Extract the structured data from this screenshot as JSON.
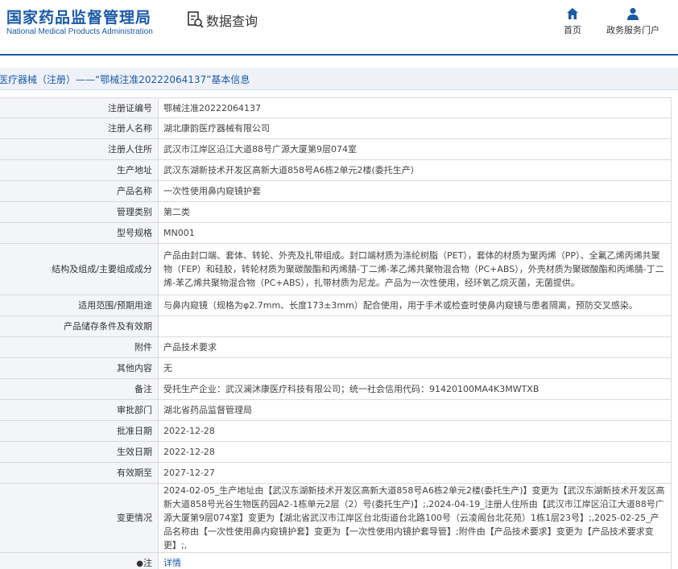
{
  "site": {
    "name_cn": "国家药品监督管理局",
    "name_en": "National Medical Products Administration",
    "query_title": "数据查询"
  },
  "nav": {
    "home": "首页",
    "portal": "政务服务门户"
  },
  "breadcrumb": "医疗器械（注册）——“鄂械注准20222064137”基本信息",
  "rows": [
    {
      "label": "注册证编号",
      "value": "鄂械注准20222064137"
    },
    {
      "label": "注册人名称",
      "value": "湖北康韵医疗器械有限公司"
    },
    {
      "label": "注册人住所",
      "value": "武汉市江岸区沿江大道88号广源大厦第9层074室"
    },
    {
      "label": "生产地址",
      "value": "武汉东湖新技术开发区高新大道858号A6栋2单元2楼(委托生产）"
    },
    {
      "label": "产品名称",
      "value": "一次性使用鼻内窥镜护套"
    },
    {
      "label": "管理类别",
      "value": "第二类"
    },
    {
      "label": "型号规格",
      "value": "MN001"
    },
    {
      "label": "结构及组成/主要组成成分",
      "value": "产品由封口端、套体、转轮、外壳及扎带组成。封口端材质为涤纶树脂（PET），套体的材质为聚丙烯（PP）、全氟乙烯丙烯共聚物（FEP）和硅胶，转轮材质为聚碳酸酯和丙烯腈-丁二烯-苯乙烯共聚物混合物（PC+ABS），外壳材质为聚碳酸酯和丙烯腈-丁二烯-苯乙烯共聚物混合物（PC+ABS），扎带材质为尼龙。产品为一次性使用，经环氧乙烷灭菌，无菌提供。"
    },
    {
      "label": "适用范围/预期用途",
      "value": "与鼻内窥镜（规格为φ2.7mm、长度173±3mm）配合使用，用于手术或检查时使鼻内窥镜与患者隔离，预防交叉感染。"
    },
    {
      "label": "产品储存条件及有效期",
      "value": ""
    },
    {
      "label": "附件",
      "value": "产品技术要求"
    },
    {
      "label": "其他内容",
      "value": "无"
    },
    {
      "label": "备注",
      "value": "受托生产企业：武汉澜沐康医疗科技有限公司；统一社会信用代码：91420100MA4K3MWTXB"
    },
    {
      "label": "审批部门",
      "value": "湖北省药品监督管理局"
    },
    {
      "label": "批准日期",
      "value": "2022-12-28"
    },
    {
      "label": "生效日期",
      "value": "2022-12-28"
    },
    {
      "label": "有效期至",
      "value": "2027-12-27"
    },
    {
      "label": "变更情况",
      "value": "2024-02-05_生产地址由【武汉东湖新技术开发区高新大道858号A6栋2单元2楼(委托生产)】变更为【武汉东湖新技术开发区高新大道858号光谷生物医药园A2-1栋单元2层（2）号(委托生产)】;,2024-04-19_注册人住所由【武汉市江岸区沿江大道88号广源大厦第9层074室】变更为【湖北省武汉市江岸区台北街道台北路100号（云凌阁台北花苑）1栋1层23号】;,2025-02-25_产品名称由【一次性使用鼻内窥镜护套】变更为【一次性使用内镜护套导管】;附件由【产品技术要求】变更为【产品技术要求变更】;,"
    }
  ],
  "note_row": {
    "label": "注",
    "value": "详情"
  },
  "colors": {
    "brand": "#1a5aa8",
    "label_bg": "#f3f5f8",
    "crumb_bg": "#eef2f8"
  },
  "icons": {
    "query": "search-document-icon",
    "home": "home-icon",
    "portal": "user-icon",
    "note": "pin-icon"
  }
}
